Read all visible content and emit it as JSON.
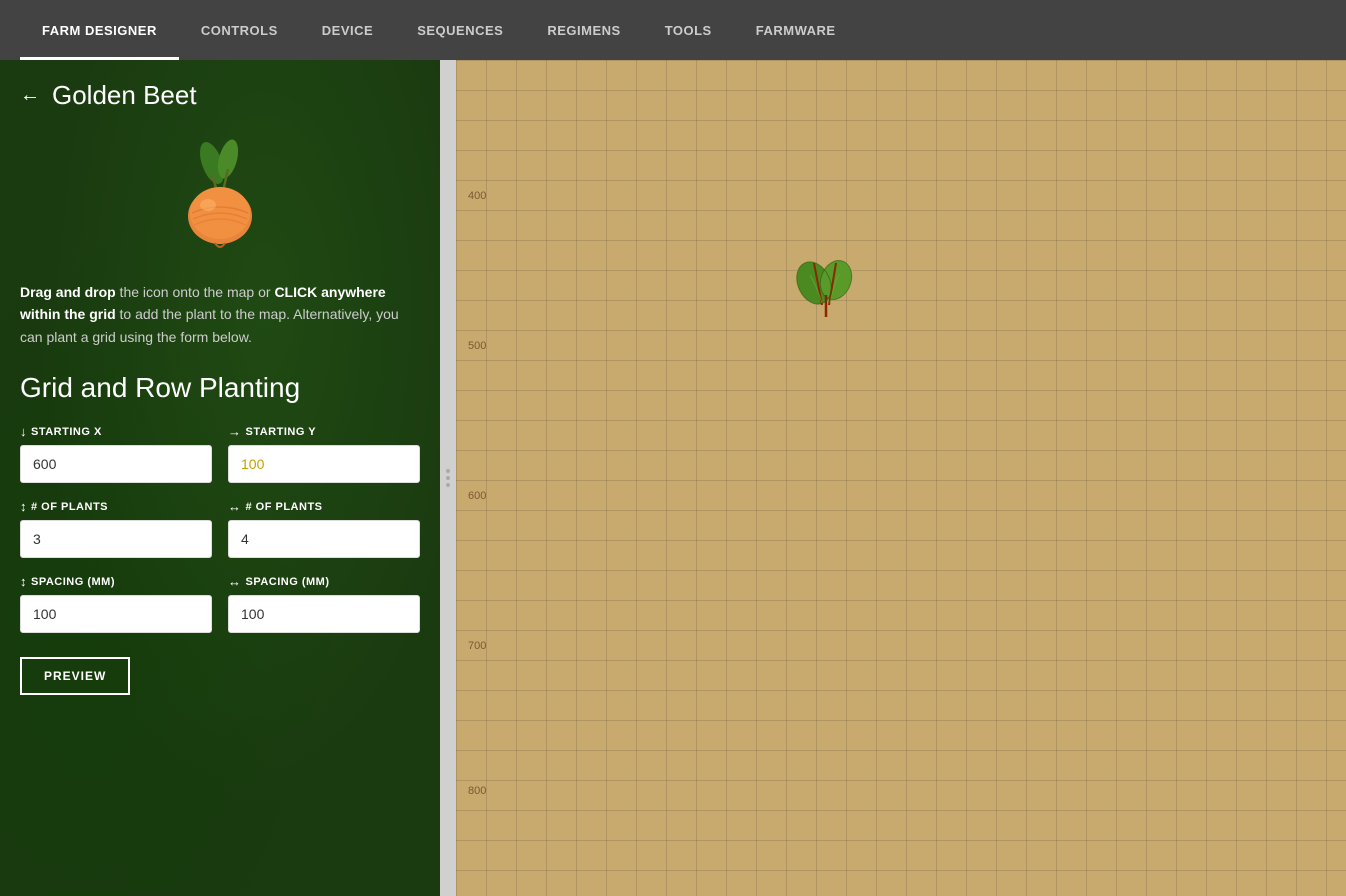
{
  "nav": {
    "items": [
      {
        "id": "farm-designer",
        "label": "FARM DESIGNER",
        "active": true
      },
      {
        "id": "controls",
        "label": "CONTROLS",
        "active": false
      },
      {
        "id": "device",
        "label": "DEVICE",
        "active": false
      },
      {
        "id": "sequences",
        "label": "SEQUENCES",
        "active": false
      },
      {
        "id": "regimens",
        "label": "REGIMENS",
        "active": false
      },
      {
        "id": "tools",
        "label": "TOOLS",
        "active": false
      },
      {
        "id": "farmware",
        "label": "FARMWARE",
        "active": false
      }
    ]
  },
  "panel": {
    "back_label": "←",
    "title": "Golden Beet",
    "instruction": {
      "part1_bold": "Drag and drop",
      "part1": " the icon onto the map or ",
      "part2_bold": "CLICK anywhere within the grid",
      "part2": " to add the plant to the map. Alternatively, you can plant a grid using the form below."
    },
    "section_title": "Grid and Row Planting",
    "fields": {
      "starting_x": {
        "label": "STARTING X",
        "icon": "↓",
        "value": "600",
        "color": "normal"
      },
      "starting_y": {
        "label": "STARTING Y",
        "icon": "→",
        "value": "100",
        "color": "yellow"
      },
      "plants_x": {
        "label": "# OF PLANTS",
        "icon": "↕",
        "value": "3",
        "color": "normal"
      },
      "plants_y": {
        "label": "# OF PLANTS",
        "icon": "↔",
        "value": "4",
        "color": "normal"
      },
      "spacing_x": {
        "label": "SPACING (MM)",
        "icon": "↕",
        "value": "100",
        "color": "normal"
      },
      "spacing_y": {
        "label": "SPACING (MM)",
        "icon": "↔",
        "value": "100",
        "color": "normal"
      }
    },
    "preview_btn": "PREVIEW"
  },
  "map": {
    "axis_labels": [
      {
        "value": "400",
        "top": "130",
        "left": "12"
      },
      {
        "value": "500",
        "top": "280",
        "left": "12"
      },
      {
        "value": "600",
        "top": "430",
        "left": "12"
      },
      {
        "value": "700",
        "top": "580",
        "left": "12"
      },
      {
        "value": "800",
        "top": "725",
        "left": "12"
      }
    ],
    "plant": {
      "top": "195",
      "left": "340"
    }
  }
}
